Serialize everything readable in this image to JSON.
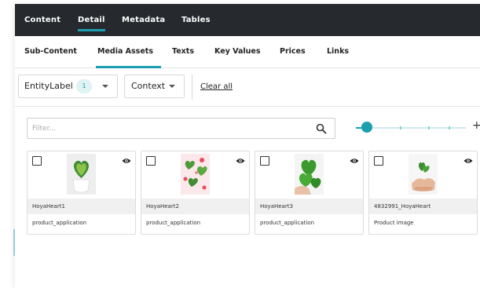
{
  "top_tabs": [
    {
      "label": "Content"
    },
    {
      "label": "Detail"
    },
    {
      "label": "Metadata"
    },
    {
      "label": "Tables"
    }
  ],
  "active_top_tab": "Detail",
  "sub_tabs": [
    {
      "label": "Sub-Content"
    },
    {
      "label": "Media Assets"
    },
    {
      "label": "Texts"
    },
    {
      "label": "Key Values"
    },
    {
      "label": "Prices"
    },
    {
      "label": "Links"
    }
  ],
  "active_sub_tab": "Media Assets",
  "filters": {
    "entity_label": "EntityLabel",
    "entity_count": "1",
    "context_label": "Context",
    "clear_all": "Clear all"
  },
  "search": {
    "placeholder": "Filter...",
    "icon": "search-icon"
  },
  "zoom": {
    "level": 0.1,
    "plus": "+"
  },
  "cards": [
    {
      "name": "HoyaHeart1",
      "type": "product_application",
      "thumb": "potted-heart-plant"
    },
    {
      "name": "HoyaHeart2",
      "type": "product_application",
      "thumb": "hearts-on-pink"
    },
    {
      "name": "HoyaHeart3",
      "type": "product_application",
      "thumb": "hand-holding-leaves"
    },
    {
      "name": "4832991_HoyaHeart",
      "type": "Product image",
      "thumb": "hands-with-cutting"
    }
  ],
  "colors": {
    "accent": "#1a9fb0",
    "topbar": "#262a2e"
  }
}
